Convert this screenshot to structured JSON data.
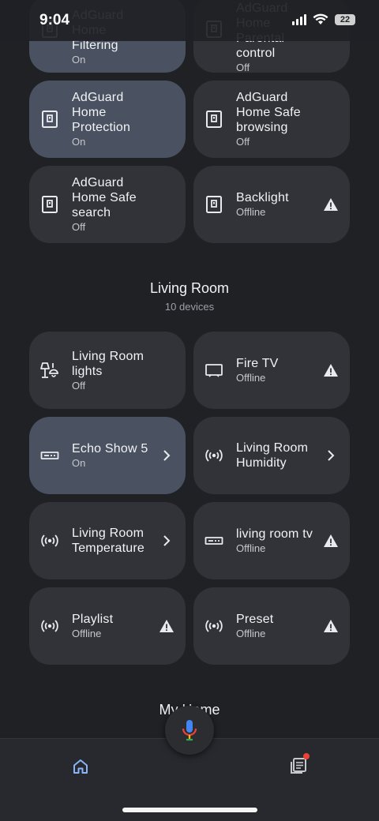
{
  "status_bar": {
    "time": "9:04",
    "battery": "22"
  },
  "tiles_top": [
    {
      "name": "AdGuard Home Filtering",
      "status": "On",
      "icon": "adguard-switch-icon",
      "active": true
    },
    {
      "name": "AdGuard Home Parental control",
      "status": "Off",
      "icon": "adguard-switch-icon",
      "active": false
    },
    {
      "name": "AdGuard Home Protection",
      "status": "On",
      "icon": "adguard-switch-icon",
      "active": true
    },
    {
      "name": "AdGuard Home Safe browsing",
      "status": "Off",
      "icon": "adguard-switch-icon",
      "active": false
    },
    {
      "name": "AdGuard Home Safe search",
      "status": "Off",
      "icon": "adguard-switch-icon",
      "active": false
    },
    {
      "name": "Backlight",
      "status": "Offline",
      "icon": "adguard-switch-icon",
      "active": false,
      "warning": true
    }
  ],
  "living_room": {
    "title": "Living Room",
    "subtitle": "10 devices",
    "tiles": [
      {
        "name": "Living Room lights",
        "status": "Off",
        "icon": "lamp-icon",
        "active": false
      },
      {
        "name": "Fire TV",
        "status": "Offline",
        "icon": "tv-icon",
        "active": false,
        "warning": true
      },
      {
        "name": "Echo Show 5",
        "status": "On",
        "icon": "display-device-icon",
        "active": true,
        "chevron": true
      },
      {
        "name": "Living Room Humidity",
        "status": "",
        "icon": "sensor-icon",
        "active": false,
        "chevron": true
      },
      {
        "name": "Living Room Temperature",
        "status": "",
        "icon": "sensor-icon",
        "active": false,
        "chevron": true
      },
      {
        "name": "living room tv",
        "status": "Offline",
        "icon": "display-device-icon",
        "active": false,
        "warning": true
      },
      {
        "name": "Playlist",
        "status": "Offline",
        "icon": "sensor-icon",
        "active": false,
        "warning": true
      },
      {
        "name": "Preset",
        "status": "Offline",
        "icon": "sensor-icon",
        "active": false,
        "warning": true
      }
    ]
  },
  "next_section": {
    "title": "My Home"
  },
  "bottom_nav": {
    "home_icon": "home-icon",
    "feed_icon": "feed-icon",
    "mic_icon": "mic-icon"
  },
  "colors": {
    "background": "#1f2125",
    "tile": "#313338",
    "tile_active": "#4a5262",
    "accent": "#8ab4f8"
  }
}
